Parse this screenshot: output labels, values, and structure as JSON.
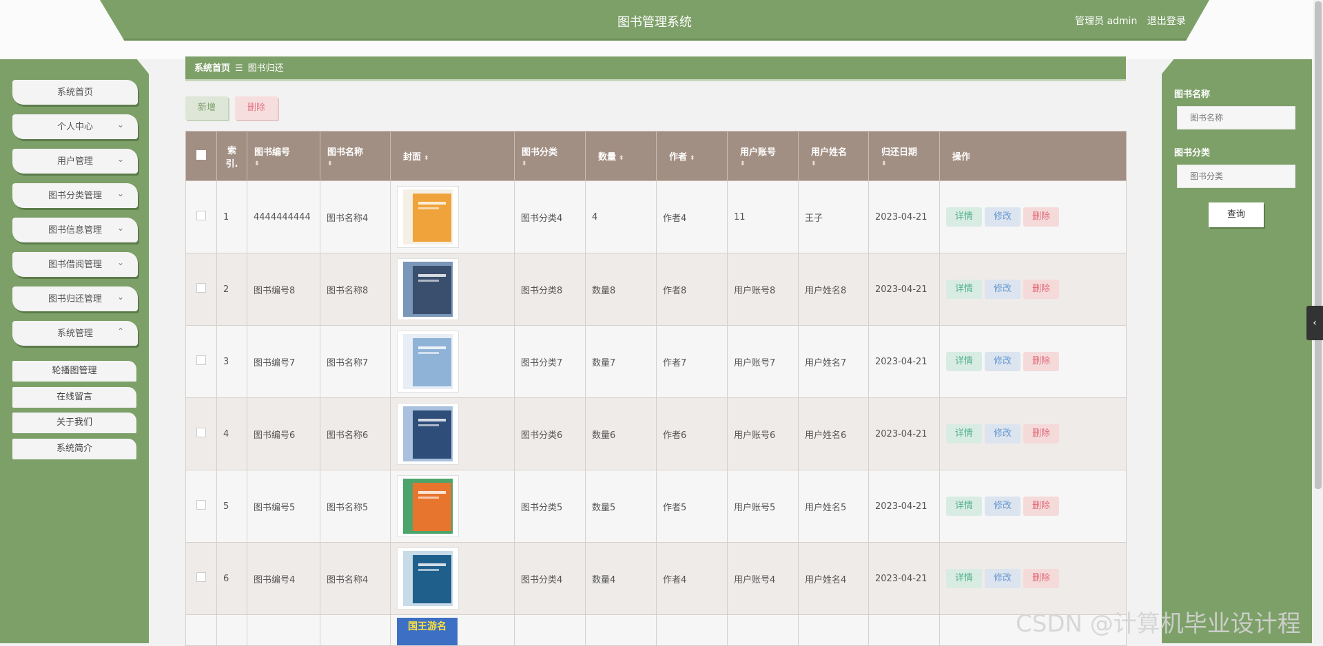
{
  "header": {
    "title": "图书管理系统",
    "user_label": "管理员 admin",
    "logout_label": "退出登录"
  },
  "sidebar": {
    "items": [
      {
        "label": "系统首页",
        "chevron": ""
      },
      {
        "label": "个人中心",
        "chevron": "⌄"
      },
      {
        "label": "用户管理",
        "chevron": "⌄"
      },
      {
        "label": "图书分类管理",
        "chevron": "⌄"
      },
      {
        "label": "图书信息管理",
        "chevron": "⌄"
      },
      {
        "label": "图书借阅管理",
        "chevron": "⌄"
      },
      {
        "label": "图书归还管理",
        "chevron": "⌄"
      },
      {
        "label": "系统管理",
        "chevron": "⌃"
      }
    ],
    "sub_items": [
      {
        "label": "轮播图管理"
      },
      {
        "label": "在线留言"
      },
      {
        "label": "关于我们"
      },
      {
        "label": "系统简介"
      }
    ]
  },
  "breadcrumb": {
    "home": "系统首页",
    "separator": "☰",
    "current": "图书归还"
  },
  "toolbar": {
    "add_label": "新增",
    "delete_label": "删除"
  },
  "table": {
    "headers": [
      "索引",
      "图书编号",
      "图书名称",
      "封面",
      "图书分类",
      "数量",
      "作者",
      "用户账号",
      "用户姓名",
      "归还日期",
      "操作"
    ],
    "index_header_lines": [
      "索",
      "引."
    ],
    "sort_icon": "⬍",
    "actions": {
      "view": "详情",
      "edit": "修改",
      "delete": "删除"
    },
    "rows": [
      {
        "index": "1",
        "book_no": "4444444444",
        "book_name": "图书名称4",
        "category": "图书分类4",
        "qty": "4",
        "author": "作者4",
        "account": "11",
        "username": "王子",
        "date": "2023-04-21",
        "cover_color": "#f0a33a",
        "cover_accent": "#f5f0e6"
      },
      {
        "index": "2",
        "book_no": "图书编号8",
        "book_name": "图书名称8",
        "category": "图书分类8",
        "qty": "数量8",
        "author": "作者8",
        "account": "用户账号8",
        "username": "用户姓名8",
        "date": "2023-04-21",
        "cover_color": "#3a4f6e",
        "cover_accent": "#7a96b8"
      },
      {
        "index": "3",
        "book_no": "图书编号7",
        "book_name": "图书名称7",
        "category": "图书分类7",
        "qty": "数量7",
        "author": "作者7",
        "account": "用户账号7",
        "username": "用户姓名7",
        "date": "2023-04-21",
        "cover_color": "#8fb3d6",
        "cover_accent": "#e8eef5"
      },
      {
        "index": "4",
        "book_no": "图书编号6",
        "book_name": "图书名称6",
        "category": "图书分类6",
        "qty": "数量6",
        "author": "作者6",
        "account": "用户账号6",
        "username": "用户姓名6",
        "date": "2023-04-21",
        "cover_color": "#2e4d78",
        "cover_accent": "#a9c1de"
      },
      {
        "index": "5",
        "book_no": "图书编号5",
        "book_name": "图书名称5",
        "category": "图书分类5",
        "qty": "数量5",
        "author": "作者5",
        "account": "用户账号5",
        "username": "用户姓名5",
        "date": "2023-04-21",
        "cover_color": "#e8752d",
        "cover_accent": "#4ca36b"
      },
      {
        "index": "6",
        "book_no": "图书编号4",
        "book_name": "图书名称4",
        "category": "图书分类4",
        "qty": "数量4",
        "author": "作者4",
        "account": "用户账号4",
        "username": "用户姓名4",
        "date": "2023-04-21",
        "cover_color": "#1f5f8c",
        "cover_accent": "#c7dbe8"
      }
    ],
    "partial_row_cover_title": "国王游名"
  },
  "search": {
    "name_label": "图书名称",
    "name_placeholder": "图书名称",
    "category_label": "图书分类",
    "category_placeholder": "图书分类",
    "button_label": "查询"
  },
  "watermark": "CSDN @计算机毕业设计程",
  "colors": {
    "primary": "#7da068",
    "table_header": "#a28f83",
    "view": "#52b08a",
    "edit": "#6b9bd1",
    "delete": "#e06b7a"
  }
}
